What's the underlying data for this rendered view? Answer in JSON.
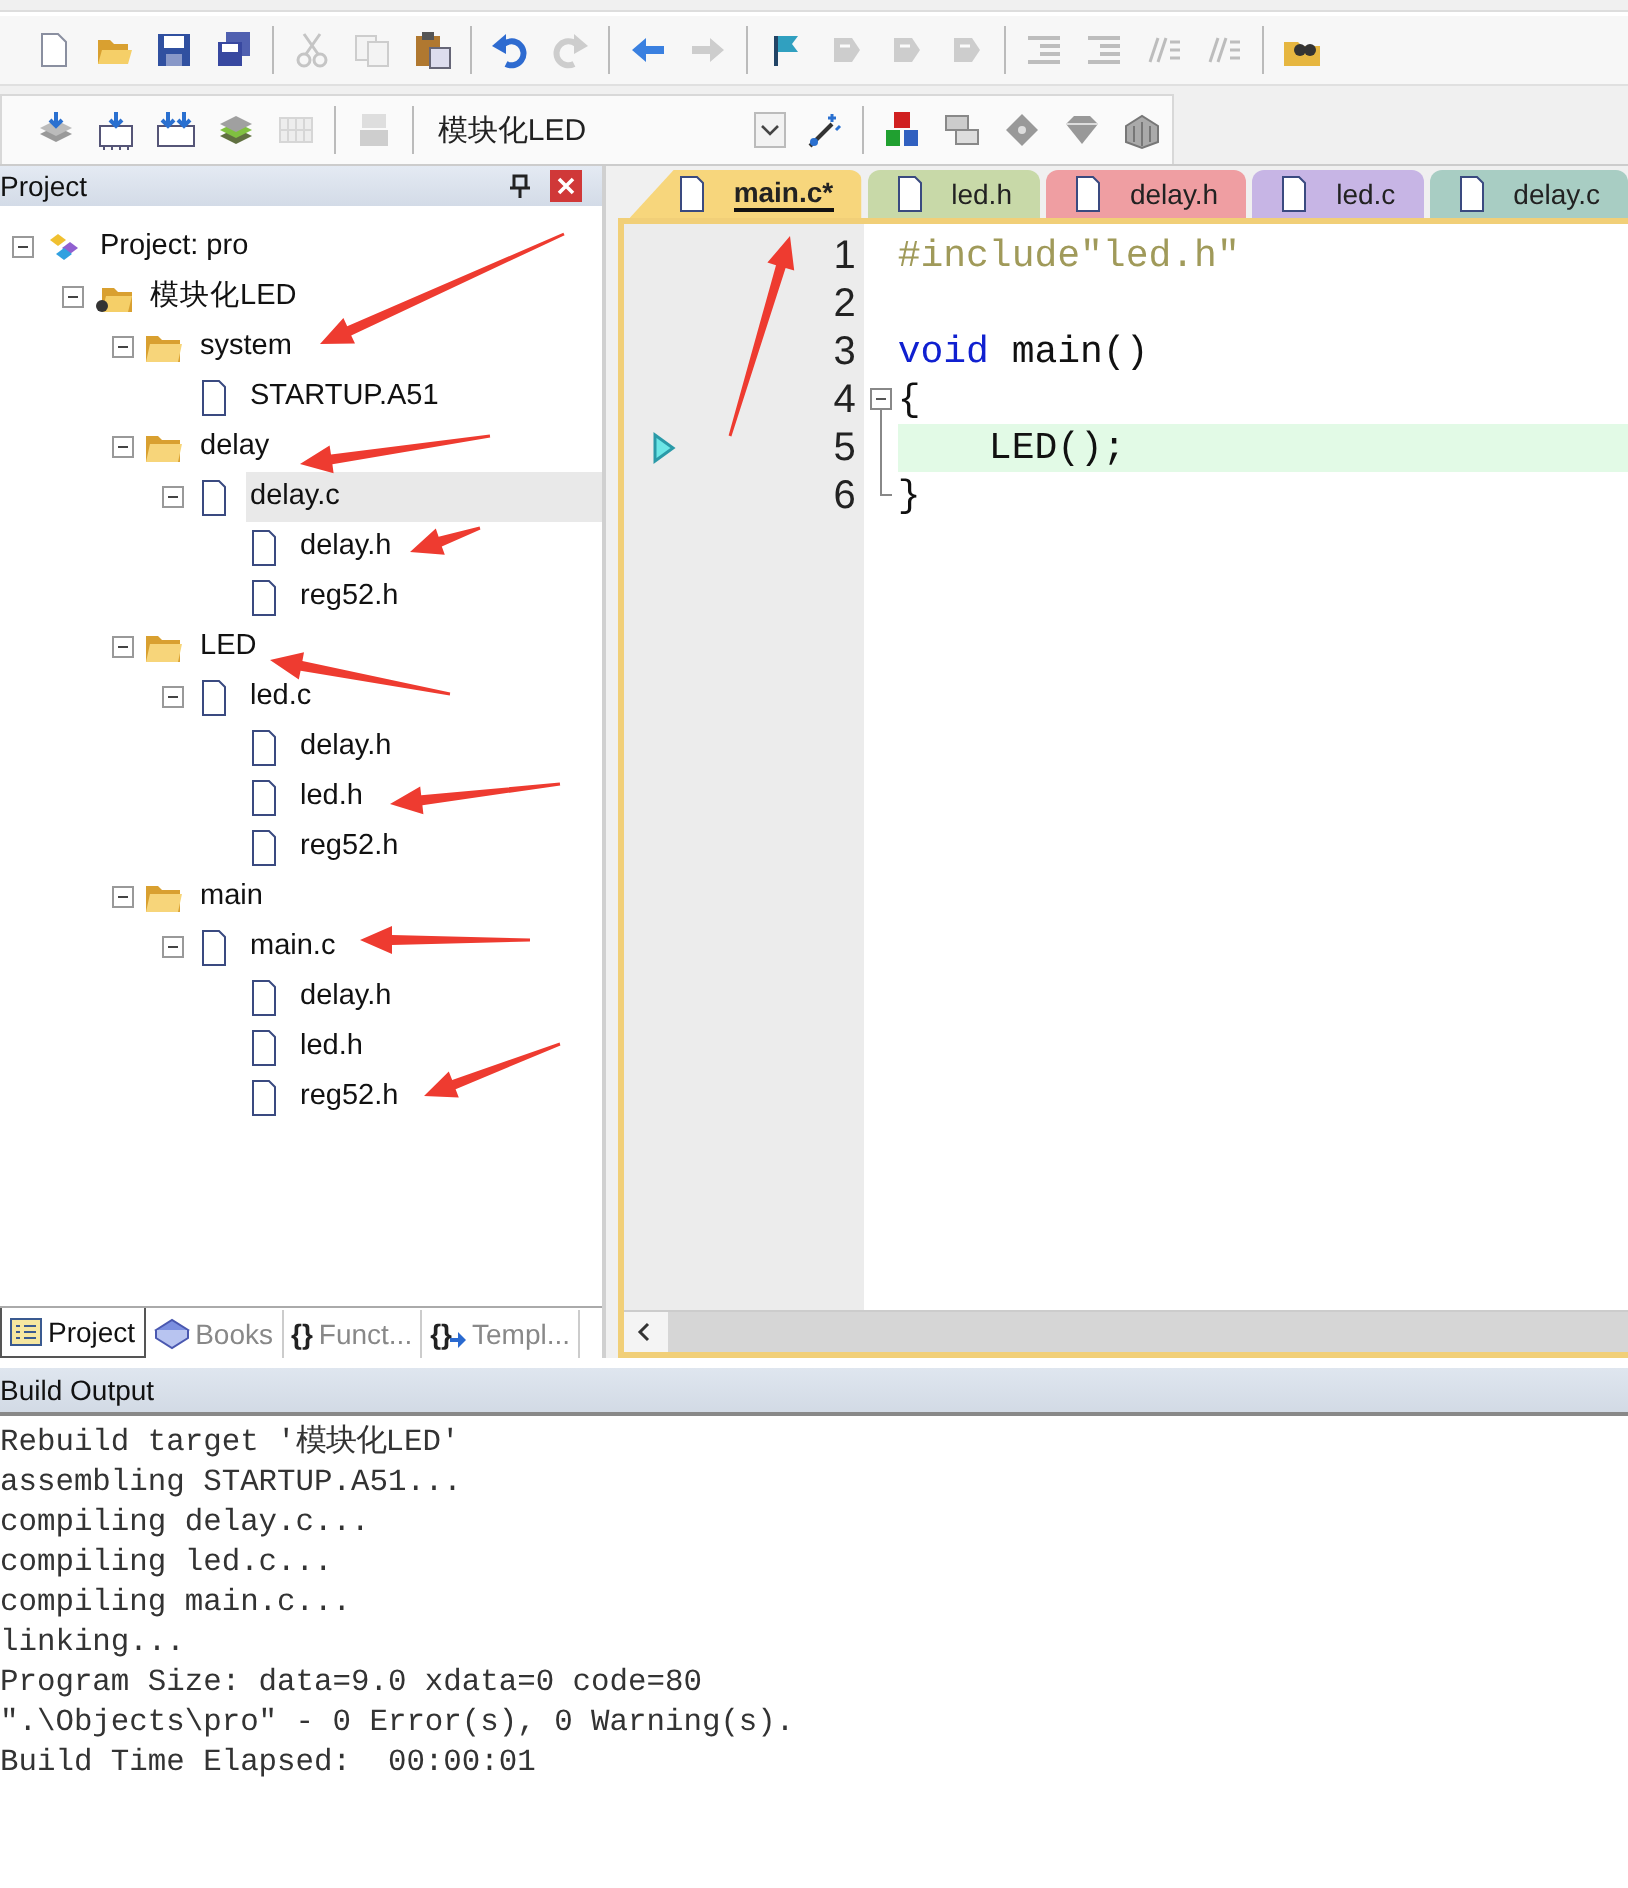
{
  "toolbar_1": [
    {
      "kind": "button",
      "disabled": false
    },
    {
      "kind": "button",
      "disabled": false
    },
    {
      "kind": "button",
      "disabled": false
    },
    {
      "kind": "button",
      "disabled": false
    },
    {
      "kind": "separator"
    },
    {
      "kind": "button",
      "disabled": true
    },
    {
      "kind": "button",
      "disabled": true
    },
    {
      "kind": "button",
      "disabled": false
    },
    {
      "kind": "separator"
    },
    {
      "kind": "button",
      "disabled": false
    },
    {
      "kind": "button",
      "disabled": true
    },
    {
      "kind": "separator"
    },
    {
      "kind": "button",
      "disabled": false
    },
    {
      "kind": "button",
      "disabled": true
    },
    {
      "kind": "separator"
    },
    {
      "kind": "button",
      "disabled": false
    },
    {
      "kind": "button",
      "disabled": true
    },
    {
      "kind": "button",
      "disabled": true
    },
    {
      "kind": "button",
      "disabled": true
    },
    {
      "kind": "separator"
    },
    {
      "kind": "button",
      "disabled": true
    },
    {
      "kind": "button",
      "disabled": true
    },
    {
      "kind": "button",
      "disabled": true
    },
    {
      "kind": "button",
      "disabled": true
    },
    {
      "kind": "separator"
    },
    {
      "kind": "button",
      "disabled": false
    }
  ],
  "toolbar_2": [
    {
      "kind": "button",
      "disabled": false
    },
    {
      "kind": "button",
      "disabled": false
    },
    {
      "kind": "button",
      "disabled": false
    },
    {
      "kind": "button",
      "disabled": false
    },
    {
      "kind": "button",
      "disabled": true
    },
    {
      "kind": "separator"
    },
    {
      "kind": "button",
      "disabled": true
    },
    {
      "kind": "separator"
    },
    {
      "kind": "select",
      "value": "模块化LED"
    },
    {
      "kind": "button",
      "disabled": false
    },
    {
      "kind": "separator"
    },
    {
      "kind": "button",
      "disabled": false
    },
    {
      "kind": "button",
      "disabled": false
    },
    {
      "kind": "button",
      "disabled": false
    },
    {
      "kind": "button",
      "disabled": false
    },
    {
      "kind": "button",
      "disabled": false
    }
  ],
  "project_panel": {
    "title": "Project",
    "tree": [
      {
        "label": "Project: pro",
        "kind": "project",
        "expanded": true,
        "selected": false,
        "children": [
          {
            "label": "模块化LED",
            "kind": "target",
            "expanded": true,
            "selected": false,
            "children": [
              {
                "label": "system",
                "kind": "group",
                "expanded": true,
                "selected": false,
                "children": [
                  {
                    "label": "STARTUP.A51",
                    "kind": "file",
                    "selected": false
                  }
                ]
              },
              {
                "label": "delay",
                "kind": "group",
                "expanded": true,
                "selected": false,
                "children": [
                  {
                    "label": "delay.c",
                    "kind": "file",
                    "expanded": true,
                    "selected": true,
                    "children": [
                      {
                        "label": "delay.h",
                        "kind": "file",
                        "selected": false
                      },
                      {
                        "label": "reg52.h",
                        "kind": "file",
                        "selected": false
                      }
                    ]
                  }
                ]
              },
              {
                "label": "LED",
                "kind": "group",
                "expanded": true,
                "selected": false,
                "children": [
                  {
                    "label": "led.c",
                    "kind": "file",
                    "expanded": true,
                    "selected": false,
                    "children": [
                      {
                        "label": "delay.h",
                        "kind": "file",
                        "selected": false
                      },
                      {
                        "label": "led.h",
                        "kind": "file",
                        "selected": false
                      },
                      {
                        "label": "reg52.h",
                        "kind": "file",
                        "selected": false
                      }
                    ]
                  }
                ]
              },
              {
                "label": "main",
                "kind": "group",
                "expanded": true,
                "selected": false,
                "children": [
                  {
                    "label": "main.c",
                    "kind": "file",
                    "expanded": true,
                    "selected": false,
                    "children": [
                      {
                        "label": "delay.h",
                        "kind": "file",
                        "selected": false
                      },
                      {
                        "label": "led.h",
                        "kind": "file",
                        "selected": false
                      },
                      {
                        "label": "reg52.h",
                        "kind": "file",
                        "selected": false
                      }
                    ]
                  }
                ]
              }
            ]
          }
        ]
      }
    ],
    "tabs": [
      {
        "label": "Project",
        "kind": "project",
        "selected": true
      },
      {
        "label": "Books",
        "kind": "books",
        "selected": false
      },
      {
        "glyph": "{}",
        "label": "Funct...",
        "kind": "functions",
        "selected": false
      },
      {
        "glyph": "{}",
        "label": "Templ...",
        "kind": "templates",
        "selected": false
      }
    ]
  },
  "editor": {
    "tabs": [
      {
        "label": "main.c*",
        "selected": true,
        "color": "#f7d67c"
      },
      {
        "label": "led.h",
        "selected": false,
        "color": "#c8d9a8"
      },
      {
        "label": "delay.h",
        "selected": false,
        "color": "#ef9ea2"
      },
      {
        "label": "led.c",
        "selected": false,
        "color": "#c7b5e5"
      },
      {
        "label": "delay.c",
        "selected": false,
        "color": "#a8cdc3"
      }
    ],
    "lines": [
      {
        "number": "1",
        "kind": "plain",
        "current": false,
        "tokens": [
          {
            "kind": "preprocessor",
            "text": "#include\"led.h\""
          }
        ]
      },
      {
        "number": "2",
        "kind": "plain",
        "current": false
      },
      {
        "number": "3",
        "kind": "plain",
        "current": false,
        "tokens": [
          {
            "kind": "keyword",
            "text": "void"
          },
          {
            "kind": "plain",
            "text": " main()"
          }
        ]
      },
      {
        "number": "4",
        "current": false,
        "kind": "fold_start",
        "tokens": [
          {
            "kind": "plain",
            "text": "{"
          }
        ]
      },
      {
        "number": "5",
        "current": true,
        "kind": "fold_body",
        "tokens": [
          {
            "kind": "plain",
            "text": "    LED();"
          }
        ]
      },
      {
        "number": "6",
        "current": false,
        "kind": "fold_end",
        "tokens": [
          {
            "kind": "plain",
            "text": "}"
          }
        ]
      }
    ]
  },
  "build_output": {
    "title": "Build Output",
    "lines": [
      "Rebuild target '模块化LED'",
      "assembling STARTUP.A51...",
      "compiling delay.c...",
      "compiling led.c...",
      "compiling main.c...",
      "linking...",
      "Program Size: data=9.0 xdata=0 code=80",
      "\".\\Objects\\pro\" - 0 Error(s), 0 Warning(s).",
      "Build Time Elapsed:  00:00:01"
    ]
  }
}
